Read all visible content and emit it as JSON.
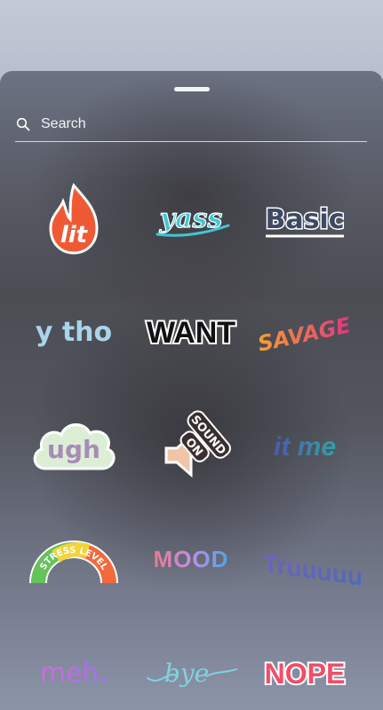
{
  "search": {
    "placeholder": "Search"
  },
  "stickers": [
    {
      "id": "lit",
      "label": "lit"
    },
    {
      "id": "yass",
      "label": "yass"
    },
    {
      "id": "basic",
      "label": "Basic"
    },
    {
      "id": "ytho",
      "label": "y tho"
    },
    {
      "id": "want",
      "label": "WANT"
    },
    {
      "id": "savage",
      "label": "SAVAGE"
    },
    {
      "id": "ugh",
      "label": "ugh"
    },
    {
      "id": "sound",
      "label_line1": "SOUND",
      "label_line2": "ON"
    },
    {
      "id": "itme",
      "label": "it me"
    },
    {
      "id": "stress",
      "label": "STRESS LEVEL"
    },
    {
      "id": "mood",
      "label": "MOOD"
    },
    {
      "id": "truuu",
      "label": "Truuuuu"
    },
    {
      "id": "meh",
      "label": "meh."
    },
    {
      "id": "bye",
      "label": "bye"
    },
    {
      "id": "nope",
      "label": "NOPE"
    }
  ],
  "colors": {
    "lit_flame": "#ef5a35",
    "yass": "#41c6d6",
    "basic": "#3d4a66",
    "ytho": "#a9d4ea",
    "savage_start": "#f7a034",
    "savage_end": "#e2357f",
    "ugh_cloud": "#dcefd6",
    "itme_start": "#4a59b4",
    "itme_end": "#2fa4a6",
    "nope": "#f24d67"
  }
}
